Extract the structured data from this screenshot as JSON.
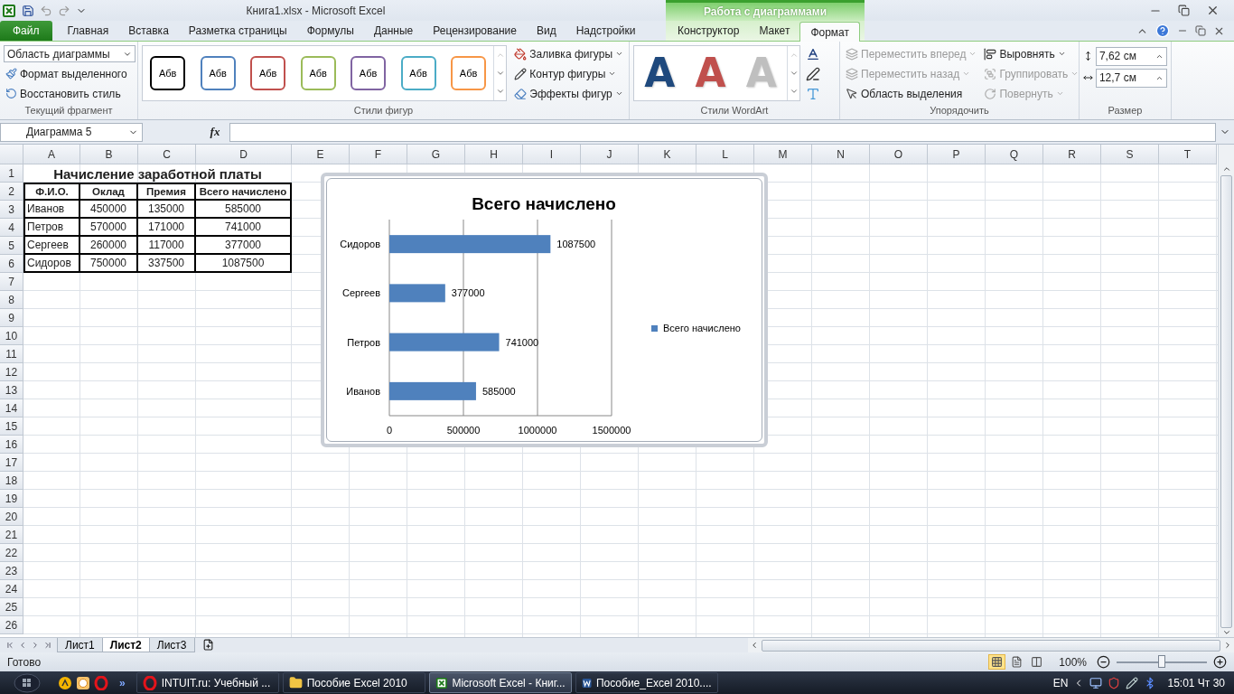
{
  "window": {
    "title": "Книга1.xlsx  -  Microsoft Excel"
  },
  "ribbon_tabs": [
    {
      "label": "Файл",
      "kind": "file",
      "selected": false
    },
    {
      "label": "Главная",
      "kind": "normal",
      "selected": false
    },
    {
      "label": "Вставка",
      "kind": "normal",
      "selected": false
    },
    {
      "label": "Разметка страницы",
      "kind": "normal",
      "selected": false
    },
    {
      "label": "Формулы",
      "kind": "normal",
      "selected": false
    },
    {
      "label": "Данные",
      "kind": "normal",
      "selected": false
    },
    {
      "label": "Рецензирование",
      "kind": "normal",
      "selected": false
    },
    {
      "label": "Вид",
      "kind": "normal",
      "selected": false
    },
    {
      "label": "Надстройки",
      "kind": "normal",
      "selected": false
    }
  ],
  "context_tabs": {
    "label": "Работа с диаграммами",
    "tabs": [
      {
        "label": "Конструктор",
        "selected": false
      },
      {
        "label": "Макет",
        "selected": false
      },
      {
        "label": "Формат",
        "selected": true
      }
    ]
  },
  "current_selection": {
    "dropdown": "Область диаграммы",
    "buttons": [
      "Формат выделенного",
      "Восстановить стиль"
    ],
    "label": "Текущий фрагмент"
  },
  "shape_styles": {
    "samples": [
      {
        "text": "Абв",
        "color": "#000000"
      },
      {
        "text": "Абв",
        "color": "#4f81bd"
      },
      {
        "text": "Абв",
        "color": "#c0504d"
      },
      {
        "text": "Абв",
        "color": "#9bbb59"
      },
      {
        "text": "Абв",
        "color": "#8064a2"
      },
      {
        "text": "Абв",
        "color": "#4bacc6"
      },
      {
        "text": "Абв",
        "color": "#f79646"
      }
    ],
    "commands": [
      {
        "label": "Заливка фигуры",
        "kind": "fill"
      },
      {
        "label": "Контур фигуры",
        "kind": "outline"
      },
      {
        "label": "Эффекты фигур",
        "kind": "effects"
      }
    ],
    "label": "Стили фигур"
  },
  "wordart_styles": {
    "samples": [
      {
        "letter": "A",
        "color": "#1f497d"
      },
      {
        "letter": "A",
        "color": "#c0504d"
      },
      {
        "letter": "A",
        "color": "#bfbfbf"
      }
    ],
    "label": "Стили WordArt"
  },
  "arrange": {
    "columns": [
      [
        {
          "label": "Переместить вперед",
          "kind": "forward",
          "disabled": true,
          "menu": true
        },
        {
          "label": "Переместить назад",
          "kind": "backward",
          "disabled": true,
          "menu": true
        },
        {
          "label": "Область выделения",
          "kind": "pane",
          "disabled": false,
          "menu": false
        }
      ],
      [
        {
          "label": "Выровнять",
          "kind": "align",
          "disabled": false,
          "menu": true
        },
        {
          "label": "Группировать",
          "kind": "group",
          "disabled": true,
          "menu": true
        },
        {
          "label": "Повернуть",
          "kind": "rotate",
          "disabled": true,
          "menu": true
        }
      ]
    ],
    "label": "Упорядочить"
  },
  "size": {
    "fields": [
      {
        "value": "7,62 см",
        "kind": "height"
      },
      {
        "value": "12,7 см",
        "kind": "width"
      }
    ],
    "label": "Размер"
  },
  "formula_bar": {
    "name_box": "Диаграмма 5",
    "fx": "fx"
  },
  "sheet": {
    "columns": [
      "A",
      "B",
      "C",
      "D",
      "E",
      "F",
      "G",
      "H",
      "I",
      "J",
      "K",
      "L",
      "M",
      "N",
      "O",
      "P",
      "Q",
      "R",
      "S",
      "T"
    ],
    "rows": [
      "1",
      "2",
      "3",
      "4",
      "5",
      "6",
      "7",
      "8",
      "9",
      "10",
      "11",
      "12",
      "13",
      "14",
      "15",
      "16",
      "17",
      "18",
      "19",
      "20",
      "21",
      "22",
      "23",
      "24",
      "25",
      "26"
    ],
    "title": "Начисление заработной платы",
    "table": {
      "columns": [
        "Ф.И.О.",
        "Оклад",
        "Премия",
        "Всего начислено"
      ],
      "rows": [
        [
          "Иванов",
          "450000",
          "135000",
          "585000"
        ],
        [
          "Петров",
          "570000",
          "171000",
          "741000"
        ],
        [
          "Сергеев",
          "260000",
          "117000",
          "377000"
        ],
        [
          "Сидоров",
          "750000",
          "337500",
          "1087500"
        ]
      ]
    }
  },
  "chart": {
    "chart_data": {
      "type": "bar",
      "orientation": "horizontal",
      "title": "Всего начислено",
      "categories": [
        "Сидоров",
        "Сергеев",
        "Петров",
        "Иванов"
      ],
      "series": [
        {
          "name": "Всего начислено",
          "color": "#4f81bd",
          "values": [
            1087500,
            377000,
            741000,
            585000
          ]
        }
      ],
      "xlim": [
        0,
        1500000
      ],
      "xticks": [
        0,
        500000,
        1000000,
        1500000
      ],
      "data_labels": true
    }
  },
  "sheet_tabs": [
    {
      "label": "Лист1",
      "selected": false
    },
    {
      "label": "Лист2",
      "selected": true
    },
    {
      "label": "Лист3",
      "selected": false
    }
  ],
  "status_bar": {
    "text": "Готово",
    "views": [
      {
        "kind": "normal",
        "selected": true
      },
      {
        "kind": "layout",
        "selected": false
      },
      {
        "kind": "break",
        "selected": false
      }
    ],
    "zoom": "100%",
    "zoom_slider": {
      "level": 0.5
    }
  },
  "taskbar": {
    "overflow": "»",
    "items": [
      {
        "label": "INTUIT.ru: Учебный ...",
        "kind": "browser",
        "selected": false
      },
      {
        "label": "Пособие Excel 2010",
        "kind": "folder",
        "selected": false
      },
      {
        "label": "Microsoft Excel - Книг...",
        "kind": "excel",
        "selected": true
      },
      {
        "label": "Пособие_Excel 2010....",
        "kind": "word",
        "selected": false
      }
    ],
    "language": "EN",
    "clock": "15:01 Чт 30"
  }
}
